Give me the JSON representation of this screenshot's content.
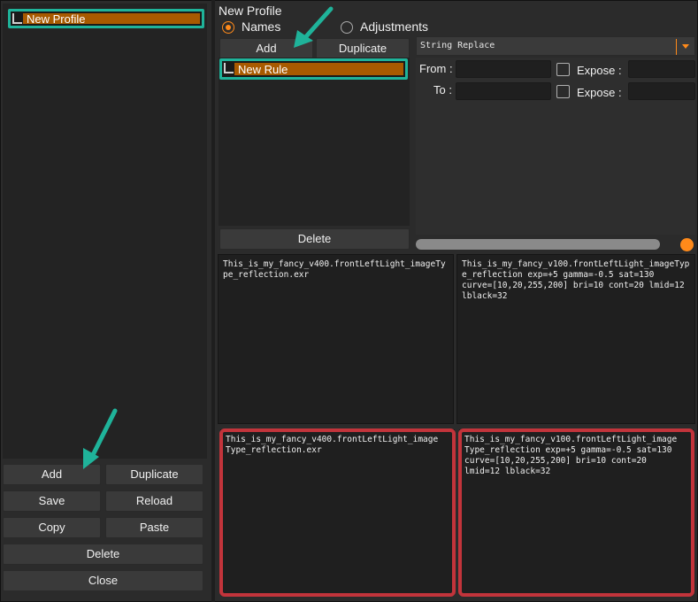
{
  "profiles": {
    "items": [
      {
        "label": "New Profile"
      }
    ],
    "buttons": {
      "add": "Add",
      "duplicate": "Duplicate",
      "save": "Save",
      "reload": "Reload",
      "copy": "Copy",
      "paste": "Paste",
      "delete": "Delete",
      "close": "Close"
    }
  },
  "editor": {
    "title": "New Profile",
    "mode_options": [
      {
        "label": "Names",
        "selected": true
      },
      {
        "label": "Adjustments",
        "selected": false
      }
    ],
    "rules": {
      "add": "Add",
      "duplicate": "Duplicate",
      "delete": "Delete",
      "items": [
        {
          "label": "New Rule"
        }
      ]
    },
    "operation": {
      "value": "String Replace"
    },
    "from_label": "From :",
    "to_label": "To :",
    "expose_label": "Expose :"
  },
  "preview": {
    "top_left": "This_is_my_fancy_v400.frontLeftLight_imageType_reflection.exr",
    "top_right": "This_is_my_fancy_v100.frontLeftLight_imageType_reflection exp=+5 gamma=-0.5 sat=130\ncurve=[10,20,255,200] bri=10 cont=20 lmid=12\nlblack=32",
    "bottom_left": "This_is_my_fancy_v400.frontLeftLight_image\nType_reflection.exr",
    "bottom_right": "This_is_my_fancy_v100.frontLeftLight_image\nType_reflection exp=+5 gamma=-0.5 sat=130\ncurve=[10,20,255,200] bri=10 cont=20\nlmid=12 lblack=32"
  },
  "colors": {
    "highlight_outline": "#1fb39a",
    "selection_fill": "#a85a00",
    "accent": "#ff8a1a",
    "annotation_red": "#c2343b"
  }
}
